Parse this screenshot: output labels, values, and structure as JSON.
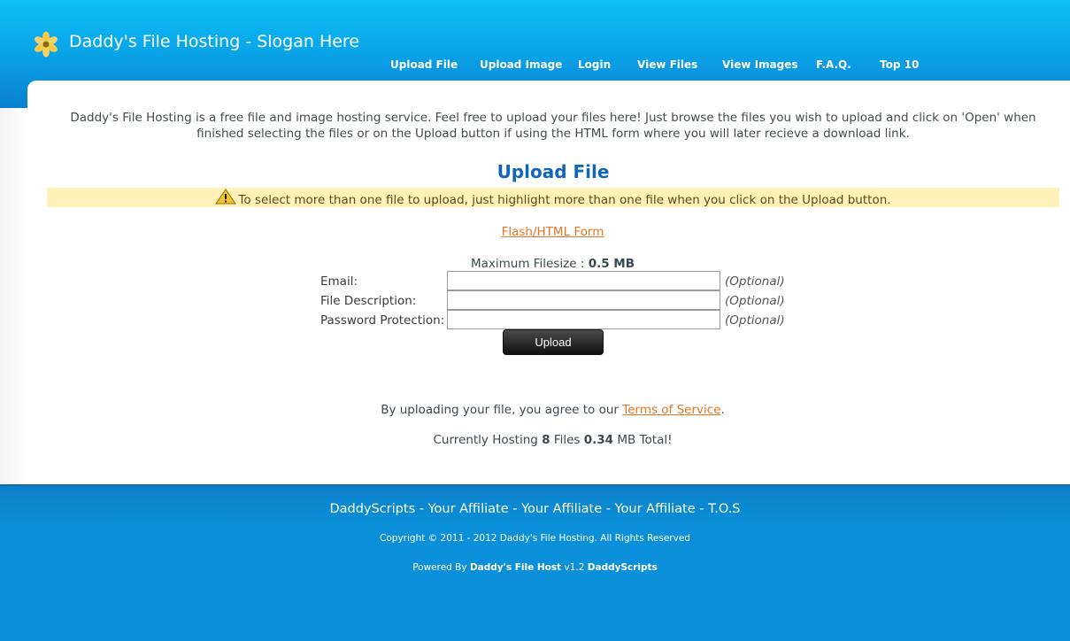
{
  "header": {
    "site_title": "Daddy's File Hosting - Slogan Here",
    "logo_icon": "flower-icon",
    "nav": [
      {
        "label": "Upload File"
      },
      {
        "label": "Upload Image"
      },
      {
        "label": "Login"
      },
      {
        "label": "View Files"
      },
      {
        "label": "View Images"
      },
      {
        "label": "F.A.Q."
      },
      {
        "label": "Top 10"
      }
    ]
  },
  "main": {
    "intro": "Daddy's File Hosting is a free file and image hosting service. Feel free to upload your files here! Just browse the files you wish to upload and click on 'Open' when finished selecting the files or on the Upload button if using the HTML form where you will later recieve a download link.",
    "upload_title": "Upload File",
    "warning_icon": "warning-icon",
    "warning_text": "To select more than one file to upload, just highlight more than one file when you click on the Upload button.",
    "form_link": "Flash/HTML Form",
    "max_filesize_label": "Maximum Filesize :",
    "max_filesize_value": "0.5 MB",
    "fields": [
      {
        "label": "Email:",
        "value": "",
        "optional": "(Optional)"
      },
      {
        "label": "File Description:",
        "value": "",
        "optional": "(Optional)"
      },
      {
        "label": "Password Protection:",
        "value": "",
        "optional": "(Optional)"
      }
    ],
    "upload_button": "Upload",
    "agree_prefix": "By uploading your file, you agree to our",
    "tos_link": "Terms of Service",
    "agree_suffix": ".",
    "hosting_prefix": "Currently Hosting",
    "hosting_files_count": "8",
    "hosting_files_label": "Files",
    "hosting_size": "0.34",
    "hosting_suffix": "MB Total!"
  },
  "footer": {
    "links": [
      {
        "label": "DaddyScripts"
      },
      {
        "label": "Your Affiliate"
      },
      {
        "label": "Your Affiliate"
      },
      {
        "label": "Your Affiliate"
      },
      {
        "label": "T.O.S"
      }
    ],
    "separator": " - ",
    "copyright": "Copyright © 2011 - 2012 Daddy's File Hosting. All Rights Reserved",
    "powered_prefix": "Powered By",
    "powered_product": "Daddy's File Host",
    "powered_version": "v1.2",
    "powered_author": "DaddyScripts"
  },
  "colors": {
    "header_top": "#0bc1f7",
    "link_orange": "#e67520",
    "title_blue": "#1166bb",
    "warning_bg": "#fff2b8"
  }
}
